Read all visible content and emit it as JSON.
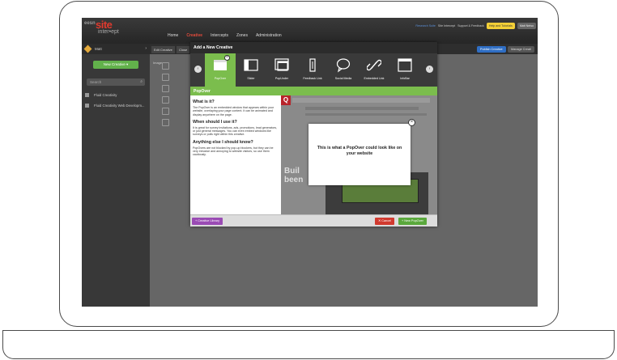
{
  "logo": {
    "site": "site",
    "small": "eesn",
    "sub": "inter•ept"
  },
  "nav": [
    "Home",
    "Creative",
    "Intercepts",
    "Zones",
    "Administration"
  ],
  "nav_active_index": 1,
  "topright": {
    "research_suite": "Research Suite",
    "site_intercept": "Site Intercept",
    "support": "Support & Feedback",
    "help": "Help and Tutorials",
    "user": "Matt Nelso"
  },
  "sidebar": {
    "folder": "Matt",
    "new_creative": "New Creative ▾",
    "search_placeholder": "Search",
    "items": [
      "Fluid Creativity",
      "Fluid Creativity Web Developm..."
    ]
  },
  "content": {
    "tab_edit": "Edit Creative",
    "tab_close": "Close",
    "publish": "Publish Creative",
    "manage": "Manage Creati",
    "canvas_label": "Image"
  },
  "modal": {
    "title": "Add a New Creative",
    "types": [
      "PopOver",
      "Slider",
      "PopUnder",
      "Feedback Link",
      "Social Media",
      "Embedded Link",
      "InfoBar"
    ],
    "selected_index": 0,
    "section": "PopOver",
    "q1": "What is it?",
    "a1": "The PopOver is an embedded window that appears within your website, overlaying your page content. It can be animated and display anywhere on the page.",
    "q2": "When should I use it?",
    "a2": "It is great for survey invitations, ads, promotions, lead generators, or just general messages. You can even embed windows like surveys or polls right within this creative.",
    "q3": "Anything else I should know?",
    "a3": "PopOvers are not blocked by pop-up blockers, but they can be very intrusive and annoying to website visitors, so use them cautiously.",
    "preview_text": "This is what a PopOver could look like on your website",
    "preview_big": "Buil\nbeen",
    "library_btn": "+ Creative Library",
    "cancel_btn": "✕ Cancel",
    "new_btn": "+ New PopOver"
  },
  "colors": {
    "accent_green": "#7bbd4d",
    "nav_active": "#e14a3b",
    "library": "#9a4bb4",
    "cancel": "#d13a2f"
  }
}
